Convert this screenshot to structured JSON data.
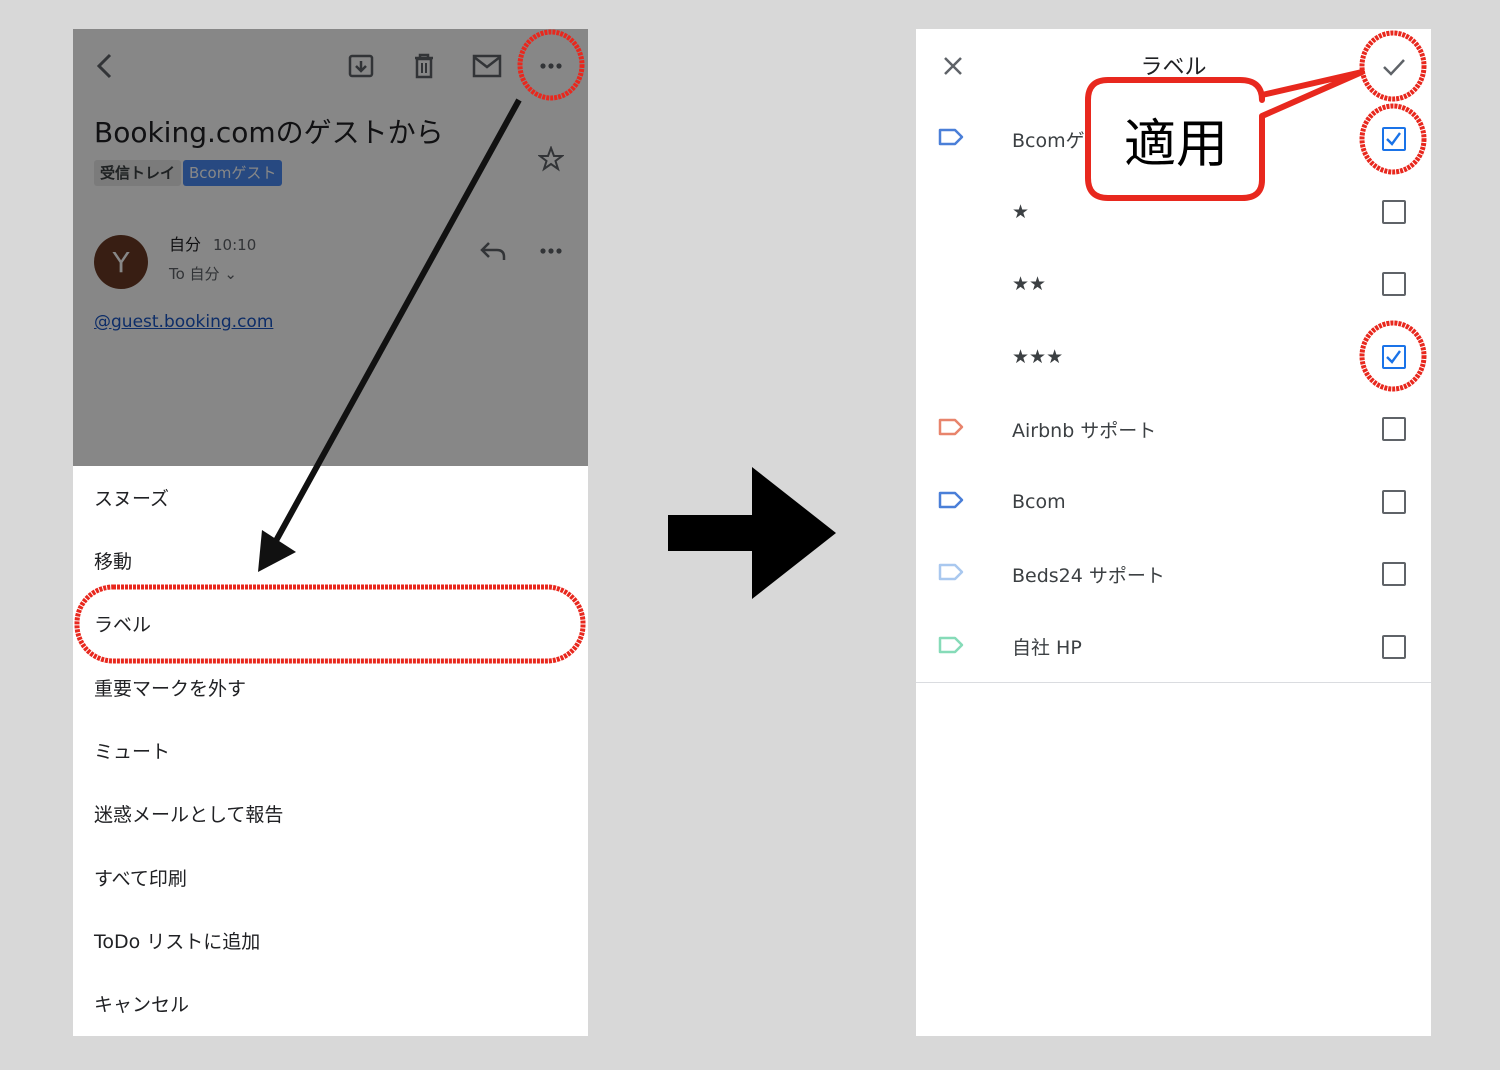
{
  "email": {
    "subject": "Booking.comのゲストから",
    "labels": {
      "inbox": "受信トレイ",
      "custom": "Bcomゲスト"
    },
    "avatar_initial": "Y",
    "sender": "自分",
    "time": "10:10",
    "recipient": "To 自分 ⌄",
    "link": "@guest.booking.com",
    "icons": [
      "back-arrow-icon",
      "archive-icon",
      "trash-icon",
      "mail-icon",
      "more-icon",
      "star-icon",
      "reply-icon"
    ]
  },
  "menu": {
    "items": [
      "スヌーズ",
      "移動",
      "ラベル",
      "重要マークを外す",
      "ミュート",
      "迷惑メールとして報告",
      "すべて印刷",
      "ToDo リストに追加",
      "キャンセル"
    ]
  },
  "label_screen": {
    "title": "ラベル",
    "rows": [
      {
        "name": "Bcomゲ",
        "tag_color": "#4a7fd8",
        "checked": true
      },
      {
        "name": "★",
        "tag_color": "",
        "checked": false
      },
      {
        "name": "★★",
        "tag_color": "",
        "checked": false
      },
      {
        "name": "★★★",
        "tag_color": "",
        "checked": true
      },
      {
        "name": "Airbnb サポート",
        "tag_color": "#e8846c",
        "checked": false
      },
      {
        "name": "Bcom",
        "tag_color": "#4a7fd8",
        "checked": false
      },
      {
        "name": "Beds24 サポート",
        "tag_color": "#a9c8ef",
        "checked": false
      },
      {
        "name": "自社 HP",
        "tag_color": "#86dbb8",
        "checked": false
      }
    ]
  },
  "annotation": {
    "callout": "適用"
  },
  "colors": {
    "annotation_red": "#e8281e",
    "checkbox_blue": "#1a73e8"
  }
}
